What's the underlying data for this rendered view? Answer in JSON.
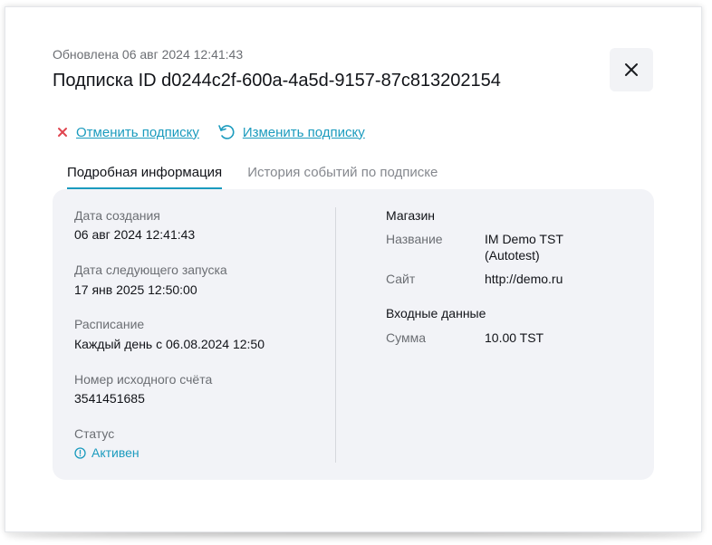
{
  "header": {
    "updated": "Обновлена 06 авг 2024 12:41:43",
    "title": "Подписка ID d0244c2f-600a-4a5d-9157-87c813202154"
  },
  "actions": {
    "cancel_label": "Отменить подписку",
    "change_label": "Изменить подписку"
  },
  "tabs": [
    {
      "label": "Подробная информация",
      "active": true
    },
    {
      "label": "История событий по подписке",
      "active": false
    }
  ],
  "details": {
    "created_label": "Дата создания",
    "created_value": "06 авг 2024 12:41:43",
    "next_run_label": "Дата следующего запуска",
    "next_run_value": "17 янв 2025 12:50:00",
    "schedule_label": "Расписание",
    "schedule_value": "Каждый день с 06.08.2024 12:50",
    "account_label": "Номер исходного счёта",
    "account_value": "3541451685",
    "status_label": "Статус",
    "status_value": "Активен"
  },
  "shop": {
    "section_title": "Магазин",
    "name_label": "Название",
    "name_value": "IM Demo TST (Autotest)",
    "site_label": "Сайт",
    "site_value": "http://demo.ru"
  },
  "input": {
    "section_title": "Входные данные",
    "amount_label": "Сумма",
    "amount_value": "10.00 TST"
  },
  "colors": {
    "accent": "#1b9bbe",
    "cancel_icon": "#e0454f",
    "panel_bg": "#f2f3f7"
  },
  "icons": {
    "close": "close-icon",
    "cancel": "x-icon",
    "change": "refresh-icon",
    "status": "info-circle-icon"
  }
}
